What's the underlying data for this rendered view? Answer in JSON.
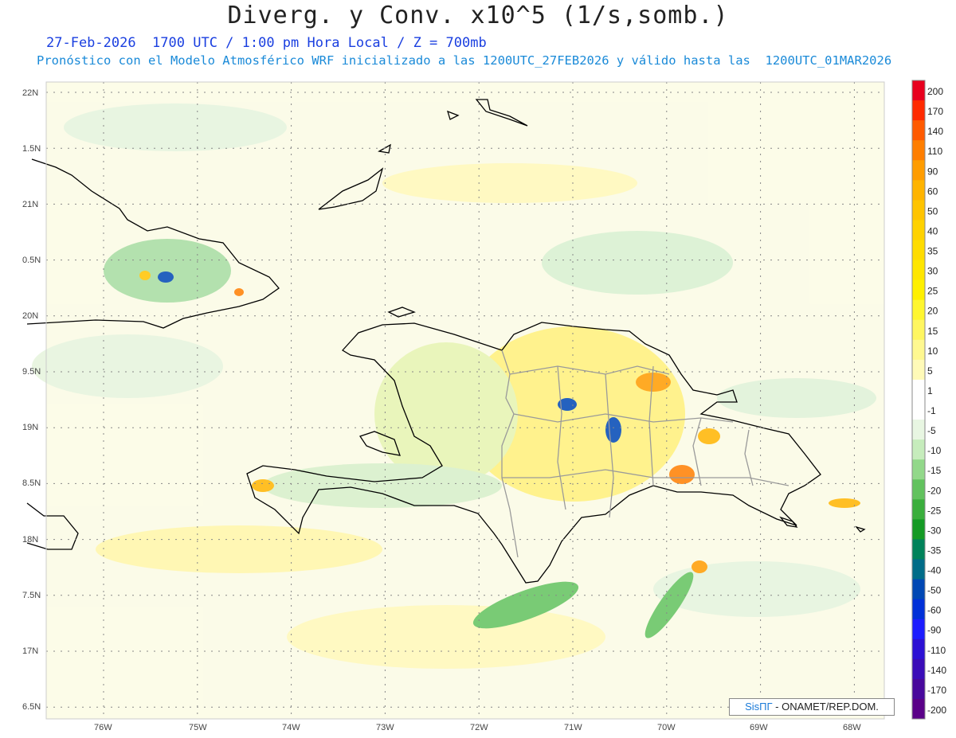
{
  "header": {
    "title": "Diverg. y Conv. x10^5 (1/s,somb.)",
    "subtitle": "27-Feb-2026  1700 UTC / 1:00 pm Hora Local / Z = 700mb",
    "info": "Pronóstico con el Modelo Atmosférico WRF inicializado a las 1200UTC_27FEB2026 y válido hasta las  1200UTC_01MAR2026"
  },
  "map": {
    "lat_labels": [
      "22N",
      "1.5N",
      "21N",
      "0.5N",
      "20N",
      "9.5N",
      "19N",
      "8.5N",
      "18N",
      "7.5N",
      "17N",
      "6.5N"
    ],
    "lon_labels": [
      "76W",
      "75W",
      "74W",
      "73W",
      "72W",
      "71W",
      "70W",
      "69W",
      "68W"
    ]
  },
  "colorbar": {
    "labels": [
      "200",
      "170",
      "140",
      "110",
      "90",
      "60",
      "50",
      "40",
      "35",
      "30",
      "25",
      "20",
      "15",
      "10",
      "5",
      "1",
      "-1",
      "-5",
      "-10",
      "-15",
      "-20",
      "-25",
      "-30",
      "-35",
      "-40",
      "-50",
      "-60",
      "-90",
      "-110",
      "-140",
      "-170",
      "-200"
    ],
    "colors": [
      "#e8001e",
      "#ff2a00",
      "#ff5a00",
      "#ff7e00",
      "#ff9c00",
      "#ffb400",
      "#ffc400",
      "#ffd200",
      "#ffdc00",
      "#ffe600",
      "#fff000",
      "#fff630",
      "#fff660",
      "#fff890",
      "#fffab8",
      "#ffffff",
      "#ffffff",
      "#e8f6e2",
      "#c6ecbc",
      "#92d88a",
      "#62c25e",
      "#3aae3c",
      "#149a24",
      "#00825a",
      "#006c88",
      "#0047b4",
      "#0030d8",
      "#1c1cff",
      "#2c10d4",
      "#3a0cb8",
      "#48089c",
      "#5a0088"
    ]
  },
  "credit": {
    "logo": "SisПГ",
    "org": "- ONAMET/REP.DOM."
  },
  "colors": {
    "title": "#222222",
    "subtitle": "#1a3fe0",
    "info": "#1a8ad8"
  }
}
